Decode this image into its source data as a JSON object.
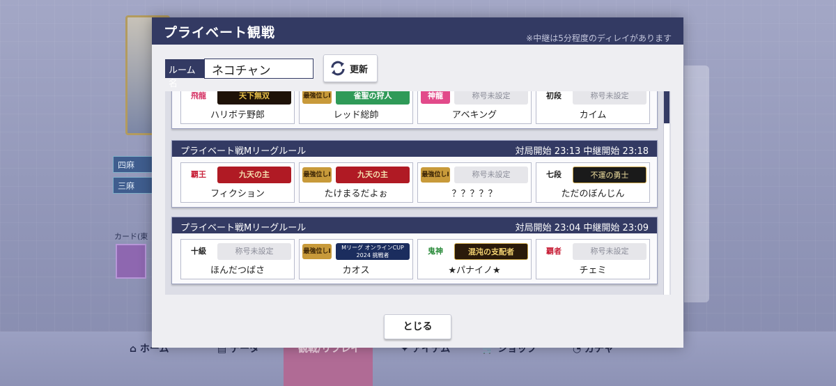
{
  "background": {
    "tags": [
      "四麻",
      "三麻"
    ],
    "card_label": "カード(東",
    "nav": [
      "ホーム",
      "データ",
      "観戦/リプレイ",
      "アイテム",
      "ショップ",
      "ガチャ"
    ]
  },
  "modal": {
    "title": "プライベート観戦",
    "note": "※中継は5分程度のディレイがあります",
    "room_label": "ルーム名",
    "room_value": "ネコチャン",
    "refresh_label": "更新",
    "close_label": "とじる"
  },
  "rooms": [
    {
      "rule": "",
      "time": "",
      "players": [
        {
          "name": "ハリボテ野郎",
          "rank": "飛龍",
          "title": "天下無双"
        },
        {
          "name": "レッド総帥",
          "rank": "最強位しI",
          "title": "雀聖の狩人"
        },
        {
          "name": "アベキング",
          "rank": "神龍",
          "title": "称号未設定"
        },
        {
          "name": "カイム",
          "rank": "初段",
          "title": "称号未設定"
        }
      ]
    },
    {
      "rule": "プライベート戦Mリーグルール",
      "time": "対局開始 23:13 中継開始 23:18",
      "players": [
        {
          "name": "フィクション",
          "rank": "覇王",
          "title": "九天の主"
        },
        {
          "name": "たけまるだよぉ",
          "rank": "最強位しI",
          "title": "九天の主"
        },
        {
          "name": "？？？？？",
          "rank": "最強位しI",
          "title": "称号未設定"
        },
        {
          "name": "ただのぼんじん",
          "rank": "七段",
          "title": "不運の勇士"
        }
      ]
    },
    {
      "rule": "プライベート戦Mリーグルール",
      "time": "対局開始 23:04 中継開始 23:09",
      "players": [
        {
          "name": "ほんだつばさ",
          "rank": "十級",
          "title": "称号未設定"
        },
        {
          "name": "カオス",
          "rank": "最強位しI",
          "title": "Mリーグ オンラインCUP 2024 挑戦者"
        },
        {
          "name": "★パナイノ★",
          "rank": "鬼神",
          "title": "混沌の支配者"
        },
        {
          "name": "チェミ",
          "rank": "覇者",
          "title": "称号未設定"
        }
      ]
    }
  ],
  "colors": {
    "header": "#333a63",
    "modal_bg": "#eeeef2",
    "unset_plate": "#e6e6ea"
  }
}
